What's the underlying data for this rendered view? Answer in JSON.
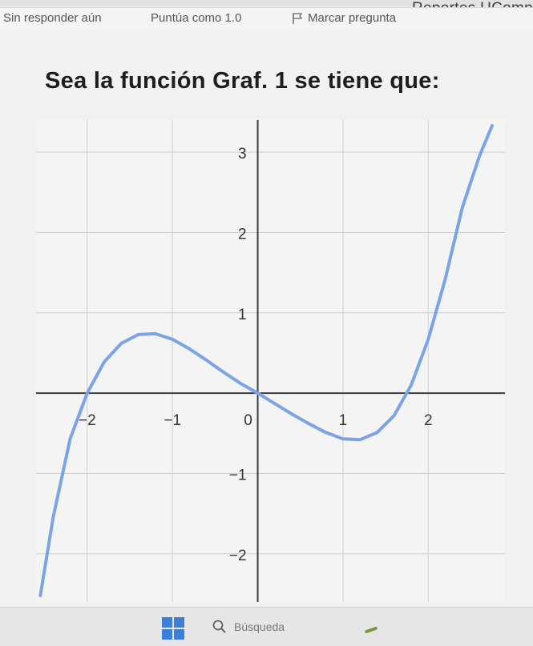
{
  "header": {
    "reports_label": "Reportes UComp"
  },
  "info_bar": {
    "status": "Sin responder aún",
    "score": "Puntúa como 1.0",
    "flag_label": "Marcar pregunta"
  },
  "question": {
    "text": "Sea la función Graf. 1 se tiene que:"
  },
  "chart_data": {
    "type": "line",
    "title": "",
    "xlabel": "",
    "ylabel": "",
    "xlim": [
      -2.6,
      2.9
    ],
    "ylim": [
      -2.6,
      3.4
    ],
    "x_ticks": [
      -2,
      -1,
      0,
      1,
      2
    ],
    "y_ticks": [
      -2,
      -1,
      1,
      2,
      3
    ],
    "x_tick_labels": [
      "−2",
      "−1",
      "0",
      "1",
      "2"
    ],
    "y_tick_labels": [
      "−2",
      "−1",
      "1",
      "2",
      "3"
    ],
    "grid": true,
    "series": [
      {
        "color": "#7ba4e6",
        "x": [
          -2.55,
          -2.4,
          -2.2,
          -2.0,
          -1.8,
          -1.6,
          -1.4,
          -1.2,
          -1.0,
          -0.8,
          -0.6,
          -0.4,
          -0.2,
          0.0,
          0.2,
          0.4,
          0.6,
          0.8,
          1.0,
          1.2,
          1.4,
          1.6,
          1.8,
          2.0,
          2.2,
          2.4,
          2.6,
          2.75
        ],
        "y": [
          -2.52,
          -1.55,
          -0.57,
          0.0,
          0.39,
          0.62,
          0.73,
          0.74,
          0.67,
          0.55,
          0.41,
          0.26,
          0.12,
          0.0,
          -0.13,
          -0.26,
          -0.38,
          -0.49,
          -0.57,
          -0.58,
          -0.49,
          -0.28,
          0.1,
          0.67,
          1.42,
          2.31,
          2.95,
          3.33
        ]
      }
    ]
  },
  "taskbar": {
    "search_label": "Búsqueda",
    "accent": "#3b7fd6"
  }
}
